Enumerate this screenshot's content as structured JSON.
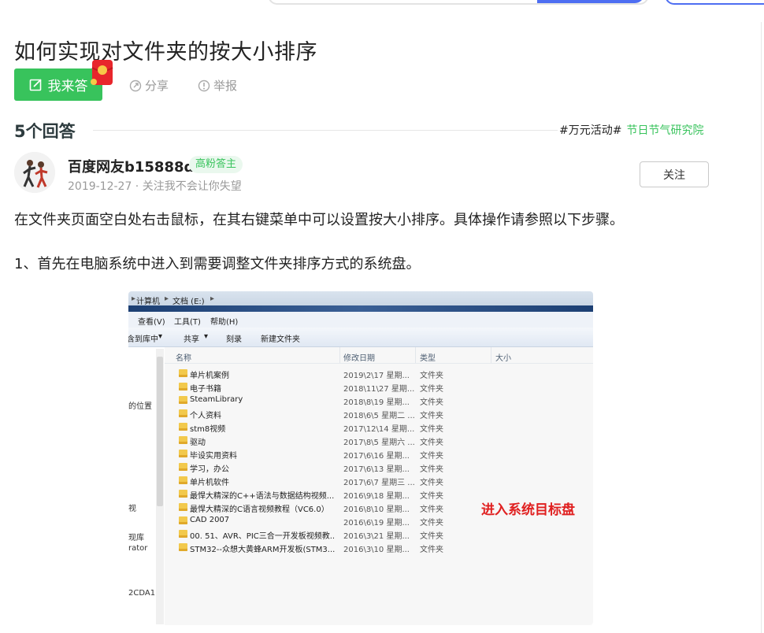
{
  "question": {
    "title": "如何实现对文件夹的按大小排序",
    "answer_button_label": "我来答",
    "share_label": "分享",
    "report_label": "举报"
  },
  "answers": {
    "count_label": "5个回答",
    "activity_tag": "#万元活动#",
    "activity_link": "节日节气研究院"
  },
  "answer": {
    "username": "百度网友b15888d",
    "badge": "高粉答主",
    "meta": "2019-12-27 · 关注我不会让你失望",
    "follow_label": "关注",
    "paragraphs": [
      "在文件夹页面空白处右击鼠标，在其右键菜单中可以设置按大小排序。具体操作请参照以下步骤。",
      "1、首先在电脑系统中进入到需要调整文件夹排序方式的系统盘。"
    ]
  },
  "screenshot": {
    "address": [
      "计算机",
      "文档 (E:)"
    ],
    "menu": [
      "查看(V)",
      "工具(T)",
      "帮助(H)"
    ],
    "toolbar": [
      "含到库中",
      "共享",
      "刻录",
      "新建文件夹"
    ],
    "nav": [
      "的位置",
      "视",
      "现库",
      "rator",
      "2CDA1"
    ],
    "columns": [
      "名称",
      "修改日期",
      "类型",
      "大小"
    ],
    "annotation": "进入系统目标盘",
    "rows": [
      {
        "name": "单片机案例",
        "date": "2019\\2\\17 星期...",
        "type": "文件夹"
      },
      {
        "name": "电子书籍",
        "date": "2018\\11\\27 星期...",
        "type": "文件夹"
      },
      {
        "name": "SteamLibrary",
        "date": "2018\\8\\19 星期...",
        "type": "文件夹"
      },
      {
        "name": "个人资料",
        "date": "2018\\6\\5 星期二 ...",
        "type": "文件夹"
      },
      {
        "name": "stm8视频",
        "date": "2017\\12\\14 星期...",
        "type": "文件夹"
      },
      {
        "name": "驱动",
        "date": "2017\\8\\5 星期六 ...",
        "type": "文件夹"
      },
      {
        "name": "毕设实用资料",
        "date": "2017\\6\\16 星期...",
        "type": "文件夹"
      },
      {
        "name": "学习，办公",
        "date": "2017\\6\\13 星期...",
        "type": "文件夹"
      },
      {
        "name": "单片机软件",
        "date": "2017\\6\\7 星期三 ...",
        "type": "文件夹"
      },
      {
        "name": "最悍大精深的C++语法与数据结构视频...",
        "date": "2016\\9\\18 星期...",
        "type": "文件夹"
      },
      {
        "name": "最悍大精深的C语言视频教程（VC6.0）",
        "date": "2016\\8\\10 星期...",
        "type": "文件夹"
      },
      {
        "name": "CAD 2007",
        "date": "2016\\6\\19 星期...",
        "type": "文件夹"
      },
      {
        "name": "00. 51、AVR、PIC三合一开发板视频教...",
        "date": "2016\\3\\21 星期...",
        "type": "文件夹"
      },
      {
        "name": "STM32--众想大黄蜂ARM开发板(STM3...",
        "date": "2016\\3\\10 星期...",
        "type": "文件夹"
      }
    ]
  },
  "colors": {
    "brand_green": "#38c35c",
    "annotation_red": "#e02020"
  }
}
